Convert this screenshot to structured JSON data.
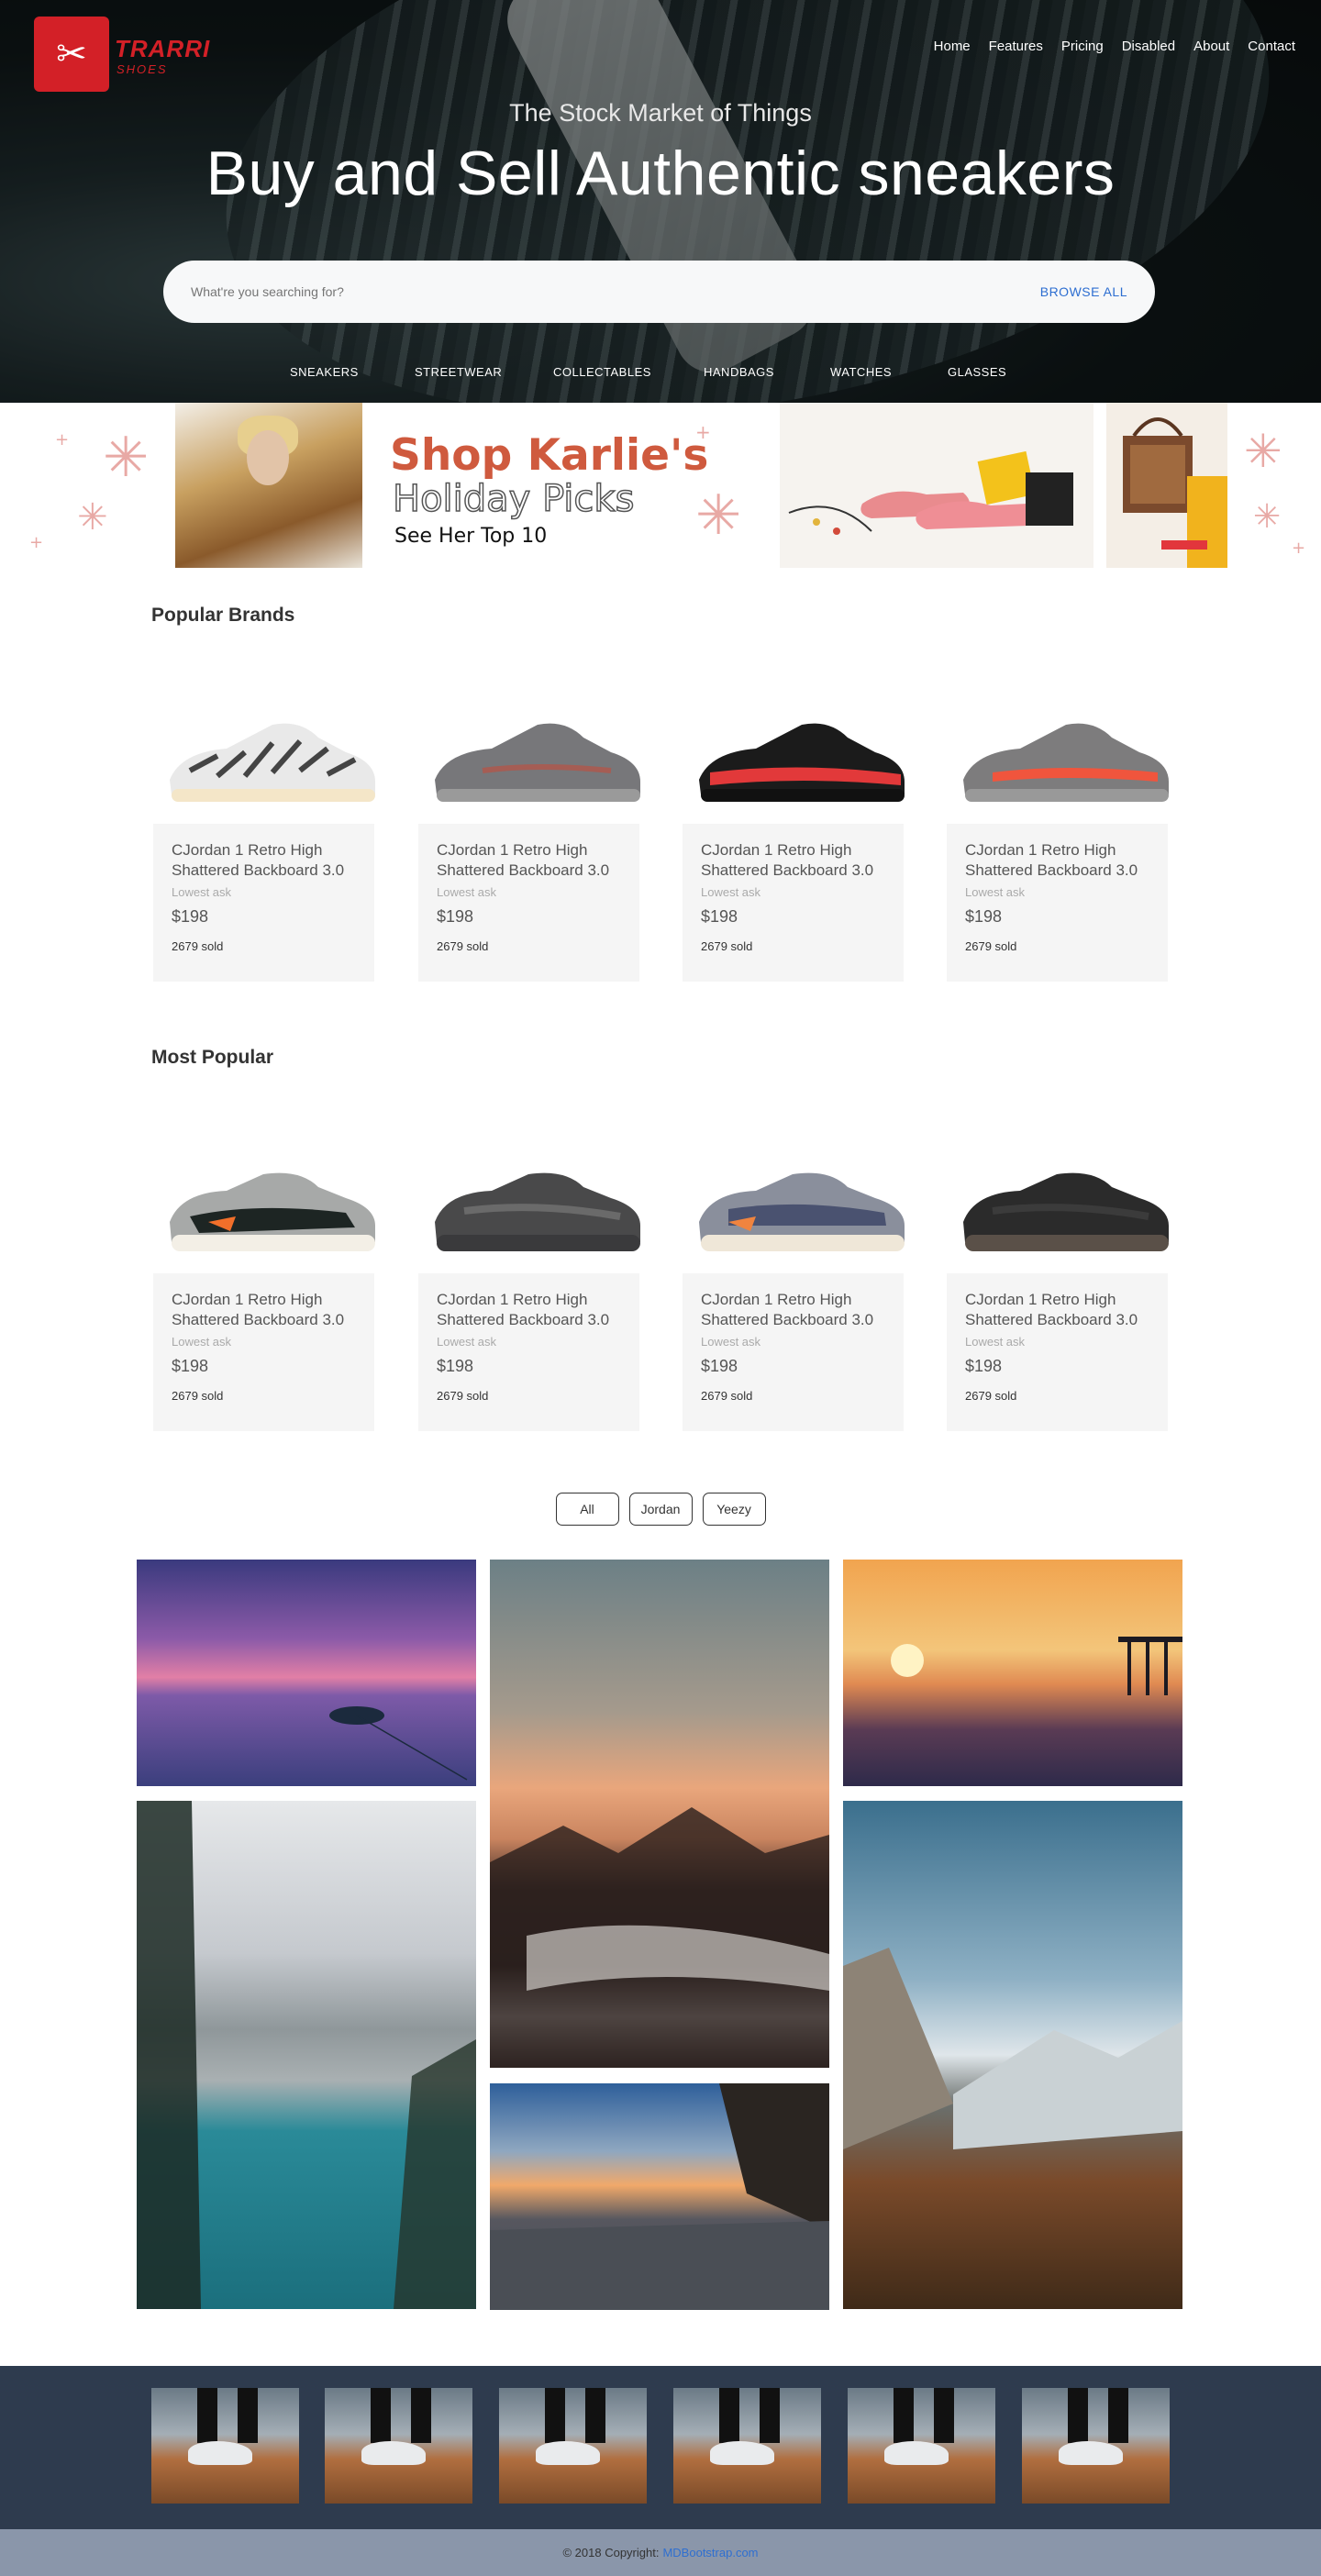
{
  "brand": {
    "logo_text": "TRARRI",
    "logo_sub": "SHOES"
  },
  "nav": [
    "Home",
    "Features",
    "Pricing",
    "Disabled",
    "About",
    "Contact"
  ],
  "hero": {
    "subtitle": "The Stock Market of Things",
    "title": "Buy and Sell Authentic sneakers",
    "search_placeholder": "What're you searching for?",
    "browse_label": "BROWSE ALL"
  },
  "categories": [
    "SNEAKERS",
    "STREETWEAR",
    "COLLECTABLES",
    "HANDBAGS",
    "WATCHES",
    "GLASSES"
  ],
  "promo": {
    "line1": "Shop Karlie's",
    "line2": "Holiday Picks",
    "line3": "See Her Top 10"
  },
  "popular_brands": {
    "title": "Popular Brands",
    "items": [
      {
        "name": "CJordan 1 Retro High Shattered Backboard 3.0",
        "lowest": "Lowest ask",
        "price": "$198",
        "sold": "2679 sold"
      },
      {
        "name": "CJordan 1 Retro High Shattered Backboard 3.0",
        "lowest": "Lowest ask",
        "price": "$198",
        "sold": "2679 sold"
      },
      {
        "name": "CJordan 1 Retro High Shattered Backboard 3.0",
        "lowest": "Lowest ask",
        "price": "$198",
        "sold": "2679 sold"
      },
      {
        "name": "CJordan 1 Retro High Shattered Backboard 3.0",
        "lowest": "Lowest ask",
        "price": "$198",
        "sold": "2679 sold"
      }
    ]
  },
  "most_popular": {
    "title": "Most Popular",
    "items": [
      {
        "name": "CJordan 1 Retro High Shattered Backboard 3.0",
        "lowest": "Lowest ask",
        "price": "$198",
        "sold": "2679 sold"
      },
      {
        "name": "CJordan 1 Retro High Shattered Backboard 3.0",
        "lowest": "Lowest ask",
        "price": "$198",
        "sold": "2679 sold"
      },
      {
        "name": "CJordan 1 Retro High Shattered Backboard 3.0",
        "lowest": "Lowest ask",
        "price": "$198",
        "sold": "2679 sold"
      },
      {
        "name": "CJordan 1 Retro High Shattered Backboard 3.0",
        "lowest": "Lowest ask",
        "price": "$198",
        "sold": "2679 sold"
      }
    ]
  },
  "filters": [
    "All",
    "Jordan",
    "Yeezy"
  ],
  "footer": {
    "copyright": "© 2018 Copyright:",
    "link": "MDBootstrap.com"
  }
}
